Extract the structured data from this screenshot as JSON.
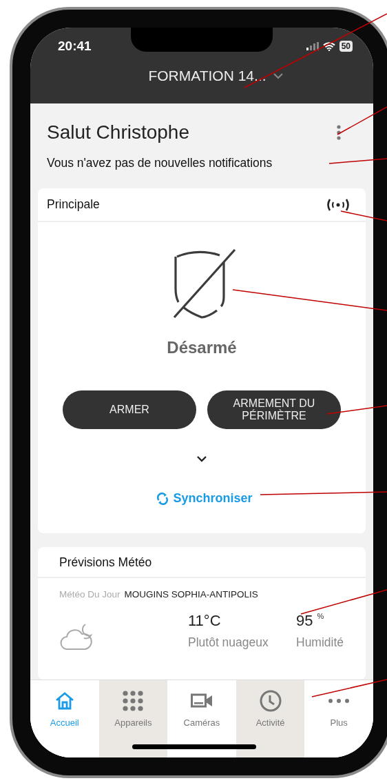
{
  "status_bar": {
    "time": "20:41",
    "battery": "50"
  },
  "header": {
    "title": "FORMATION 14..."
  },
  "greeting": "Salut Christophe",
  "notifications": "Vous n'avez pas de nouvelles notifications",
  "panel": {
    "name": "Principale",
    "armed": false,
    "state": "Désarmé",
    "buttons": [
      "ARMER",
      "ARMEMENT DU PÉRIMÈTRE"
    ],
    "sync": "Synchroniser"
  },
  "weather": {
    "title": "Prévisions Météo",
    "label": "Météo Du Jour",
    "location": "MOUGINS SOPHIA-ANTIPOLIS",
    "temperature": "11°C",
    "condition": "Plutôt nuageux",
    "humidity": "95",
    "humidity_unit": "%",
    "humidity_label": "Humidité"
  },
  "tabs": [
    {
      "label": "Accueil",
      "selected": true,
      "shaded": false
    },
    {
      "label": "Appareils",
      "selected": false,
      "shaded": true
    },
    {
      "label": "Caméras",
      "selected": false,
      "shaded": false
    },
    {
      "label": "Activité",
      "selected": false,
      "shaded": true
    },
    {
      "label": "Plus",
      "selected": false,
      "shaded": false
    }
  ]
}
